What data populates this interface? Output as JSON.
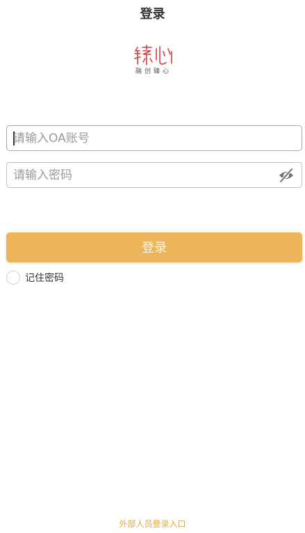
{
  "header": {
    "title": "登录"
  },
  "logo": {
    "mark_icon": "brand-logo-icon",
    "subtitle": "融创臻心",
    "brand_color": "#d23b3b"
  },
  "form": {
    "account": {
      "placeholder": "请输入OA账号",
      "value": ""
    },
    "password": {
      "placeholder": "请输入密码",
      "value": "",
      "toggle_icon": "eye-hidden-icon"
    },
    "submit_label": "登录",
    "remember_label": "记住密码",
    "remember_checked": false
  },
  "footer": {
    "external_login_label": "外部人员登录入口"
  },
  "colors": {
    "accent": "#ecb55c",
    "link": "#e8a733"
  }
}
